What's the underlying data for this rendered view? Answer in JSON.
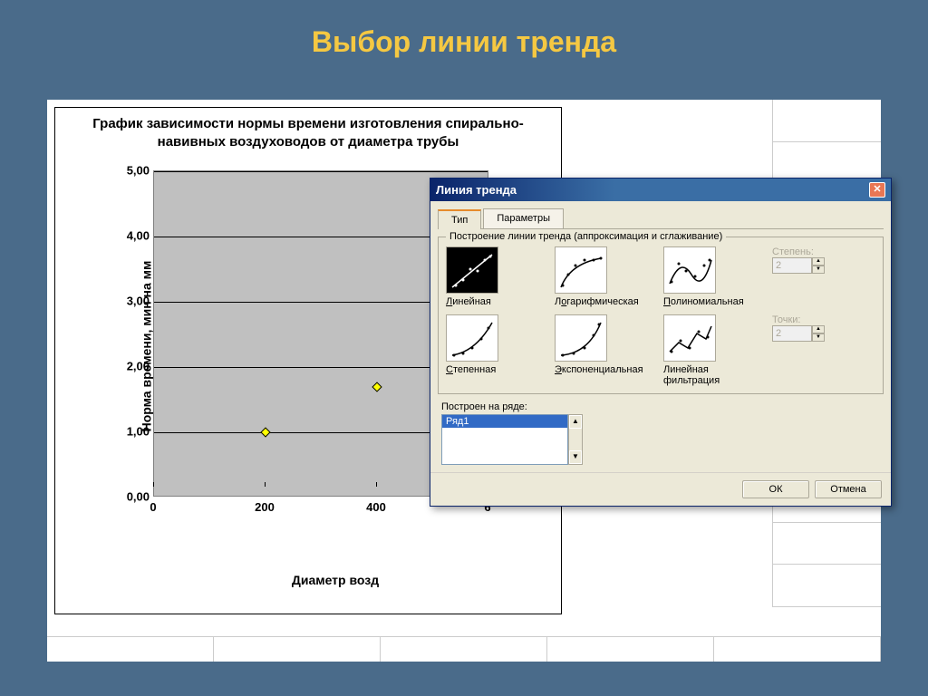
{
  "slide_title": "Выбор линии тренда",
  "chart_data": {
    "type": "scatter",
    "title": "График зависимости нормы времени изготовления спирально-навивных воздуховодов от диаметра трубы",
    "xlabel": "Диаметр возд",
    "ylabel": "Норма времени, мин на мм",
    "x_ticks": [
      "0",
      "200",
      "400",
      "6"
    ],
    "y_ticks": [
      "0,00",
      "1,00",
      "2,00",
      "3,00",
      "4,00",
      "5,00"
    ],
    "xlim": [
      0,
      600
    ],
    "ylim": [
      0,
      5
    ],
    "series": [
      {
        "name": "Ряд1",
        "x": [
          200,
          400
        ],
        "y": [
          1.0,
          1.7
        ]
      }
    ]
  },
  "dialog": {
    "title": "Линия тренда",
    "tabs": {
      "type": "Тип",
      "params": "Параметры"
    },
    "group_label": "Построение линии тренда (аппроксимация и сглаживание)",
    "types": {
      "linear": "Линейная",
      "log": "Логарифмическая",
      "poly": "Полиномиальная",
      "power": "Степенная",
      "exp": "Экспоненциальная",
      "moving": "Линейная фильтрация"
    },
    "degree_label": "Степень:",
    "degree_value": "2",
    "points_label": "Точки:",
    "points_value": "2",
    "series_label": "Построен на ряде:",
    "series_item": "Ряд1",
    "ok": "ОК",
    "cancel": "Отмена"
  }
}
